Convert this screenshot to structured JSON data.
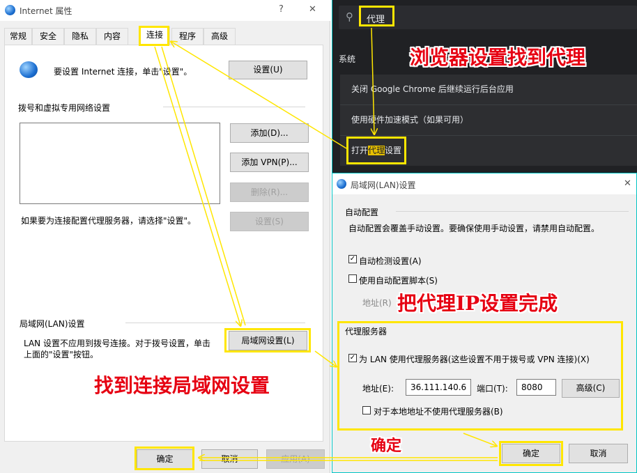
{
  "colors": {
    "annotation_highlight": "#ffe600",
    "annotation_text": "#e60012",
    "chrome_bg": "#202124",
    "dialog_bg": "#f0f0f0"
  },
  "internet_properties": {
    "title": "Internet 属性",
    "help": "?",
    "close": "✕",
    "tabs": [
      "常规",
      "安全",
      "隐私",
      "内容",
      "连接",
      "程序",
      "高级"
    ],
    "active_tab": "连接",
    "setup_text": "要设置 Internet 连接，单击\"设置\"。",
    "setup_button": "设置(U)",
    "dialup_header": "拨号和虚拟专用网络设置",
    "add_button": "添加(D)...",
    "add_vpn_button": "添加 VPN(P)...",
    "remove_button": "删除(R)...",
    "settings_button": "设置(S)",
    "proxy_hint": "如果要为连接配置代理服务器，请选择\"设置\"。",
    "lan_header": "局域网(LAN)设置",
    "lan_desc_line1": "LAN 设置不应用到拨号连接。对于拨号设置，单击",
    "lan_desc_line2": "上面的\"设置\"按钮。",
    "lan_button": "局域网设置(L)",
    "ok": "确定",
    "cancel": "取消",
    "apply": "应用(A)"
  },
  "chrome_settings": {
    "search_value": "代理",
    "section": "系统",
    "items": [
      "关闭 Google Chrome 后继续运行后台应用",
      "使用硬件加速模式（如果可用）"
    ],
    "proxy_item_prefix": "打开",
    "proxy_item_highlight": "代理",
    "proxy_item_suffix": "设置"
  },
  "lan_dialog": {
    "title": "局域网(LAN)设置",
    "close": "✕",
    "auto_config_header": "自动配置",
    "auto_config_desc": "自动配置会覆盖手动设置。要确保使用手动设置，请禁用自动配置。",
    "auto_detect_label": "自动检测设置(A)",
    "auto_detect_checked": true,
    "auto_script_label": "使用自动配置脚本(S)",
    "auto_script_checked": false,
    "address_label": "地址(R)",
    "proxy_header": "代理服务器",
    "use_proxy_label": "为 LAN 使用代理服务器(这些设置不用于拨号或 VPN 连接)(X)",
    "use_proxy_checked": true,
    "proxy_address_label": "地址(E):",
    "proxy_address": "36.111.140.6",
    "port_label": "端口(T):",
    "port": "8080",
    "advanced_button": "高级(C)",
    "bypass_label": "对于本地地址不使用代理服务器(B)",
    "bypass_checked": false,
    "ok": "确定",
    "cancel": "取消"
  },
  "annotations": {
    "browser_find_proxy": "浏览器设置找到代理",
    "ip_done": "把代理IP设置完成",
    "find_lan": "找到连接局域网设置",
    "confirm": "确定"
  }
}
